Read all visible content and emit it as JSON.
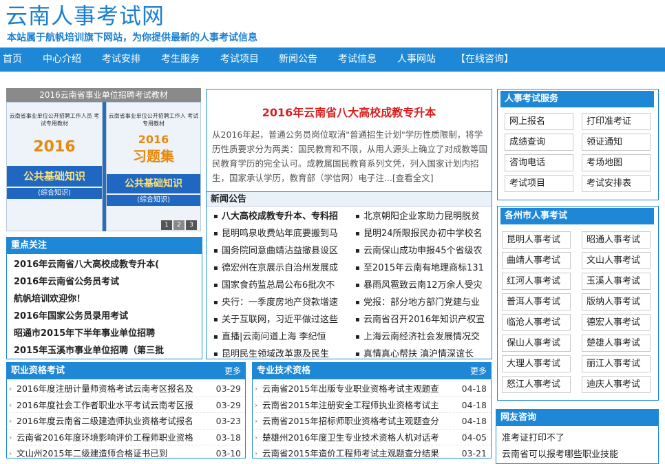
{
  "header": {
    "title": "云南人事考试网",
    "slogan": "本站属于航帆培训旗下网站，为你提供最新的人事考试信息"
  },
  "nav": [
    "首页",
    "中心介绍",
    "考试安排",
    "考生服务",
    "考试项目",
    "新闻公告",
    "考试信息",
    "人事网站",
    "【在线咨询】"
  ],
  "banner": {
    "caption": "2016云南省事业单位招聘考试教材",
    "book1": {
      "top": "云南省事业单位公开招聘工作人员 考试专用教材",
      "year": "2016",
      "band": "公共基础知识",
      "sub": "(综合知识)"
    },
    "book2": {
      "top": "云南省事业单位公开招聘工作人 考试专用教材",
      "year": "2016",
      "title": "习题集",
      "band": "公共基础知识",
      "sub": "(综合知识)"
    },
    "pages": [
      "1",
      "2",
      "3"
    ]
  },
  "focus": {
    "title": "重点关注",
    "items": [
      "2016年云南省八大高校成教专升本(",
      "2016年云南省公务员考试",
      "航帆培训欢迎你！",
      "2016年国家公务员录用考试",
      "昭通市2015年下半年事业单位招聘",
      "2015年玉溪市事业单位招聘（第三批"
    ]
  },
  "headline": {
    "title": "2016年云南省八大高校成教专升本",
    "body": "从2016年起，普通公务员岗位取消\"普通招生计划\"学历性质限制，将学历性质要求分为两类：国民教育和不限，从用人源头上确立了对成教等国民教育学历的完全认可。成教属国民教育系列文凭，列入国家计划内招生，国家承认学历，教育部（学信网）电子注...[查看全文]"
  },
  "news": {
    "title": "新闻公告",
    "left": [
      "八大高校成教专升本、专科招",
      "昆明鸣泉收费站年底要搬到马",
      "国务院同意曲靖沾益撤县设区",
      "德宏州在京展示自治州发展成",
      "国家食药监总局公布6批次不",
      "央行：一季度房地产贷款增速",
      "关于互联网，习近平做过这些",
      "直播|云南问道上海 李纪恒",
      "昆明民生领域改革惠及民生"
    ],
    "right": [
      "北京朝阳企业家助力昆明脱贫",
      "昆明24所限报民办初中学校名",
      "云南保山成功申报45个省级农",
      "至2015年云南有地理商标131",
      "暴雨风雹致云南12万余人受灾",
      "党报：部分地方部门党建与业",
      "云南省召开2016年知识产权宣",
      "上海云南经济社会发展情况交",
      "真情真心帮扶 滇沪情深谊长"
    ]
  },
  "service": {
    "title": "人事考试服务",
    "buttons": [
      "网上报名",
      "打印准考证",
      "成绩查询",
      "领证通知",
      "咨询电话",
      "考场地图",
      "考试项目",
      "考试安排表"
    ]
  },
  "cities": {
    "title": "各州市人事考试",
    "buttons": [
      "昆明人事考试",
      "昭通人事考试",
      "曲靖人事考试",
      "文山人事考试",
      "红河人事考试",
      "玉溪人事考试",
      "普洱人事考试",
      "版纳人事考试",
      "临沧人事考试",
      "德宏人事考试",
      "保山人事考试",
      "楚雄人事考试",
      "大理人事考试",
      "丽江人事考试",
      "怒江人事考试",
      "迪庆人事考试"
    ]
  },
  "zhiye": {
    "title": "职业资格考试",
    "more": "更多",
    "items": [
      {
        "text": "2016年度注册计量师资格考试云南考区报名及",
        "date": "03-29"
      },
      {
        "text": "2016年度社会工作者职业水平考试云南考区报",
        "date": "03-29"
      },
      {
        "text": "2016年度云南省二级建造师执业资格考试报名",
        "date": "03-23"
      },
      {
        "text": "云南省2016年度环境影响评价工程师职业资格",
        "date": "03-18"
      },
      {
        "text": "文山州2015年二级建造师合格证书已到",
        "date": "03-10"
      }
    ]
  },
  "zhuanye": {
    "title": "专业技术资格",
    "more": "更多",
    "items": [
      {
        "text": "云南省2015年出版专业职业资格考试主观题查",
        "date": "04-18"
      },
      {
        "text": "云南省2015年注册安全工程师执业资格考试主",
        "date": "04-18"
      },
      {
        "text": "云南省2015年招标师职业资格考试主观题查分",
        "date": "04-18"
      },
      {
        "text": "楚雄州2016年度卫生专业技术资格人机对话考",
        "date": "04-05"
      },
      {
        "text": "云南省2015年造价工程师考试主观题查分结果",
        "date": "03-21"
      }
    ]
  },
  "wangyou": {
    "title": "网友咨询",
    "items": [
      "准考证打印不了",
      "云南省可以报考哪些职业技能"
    ]
  }
}
